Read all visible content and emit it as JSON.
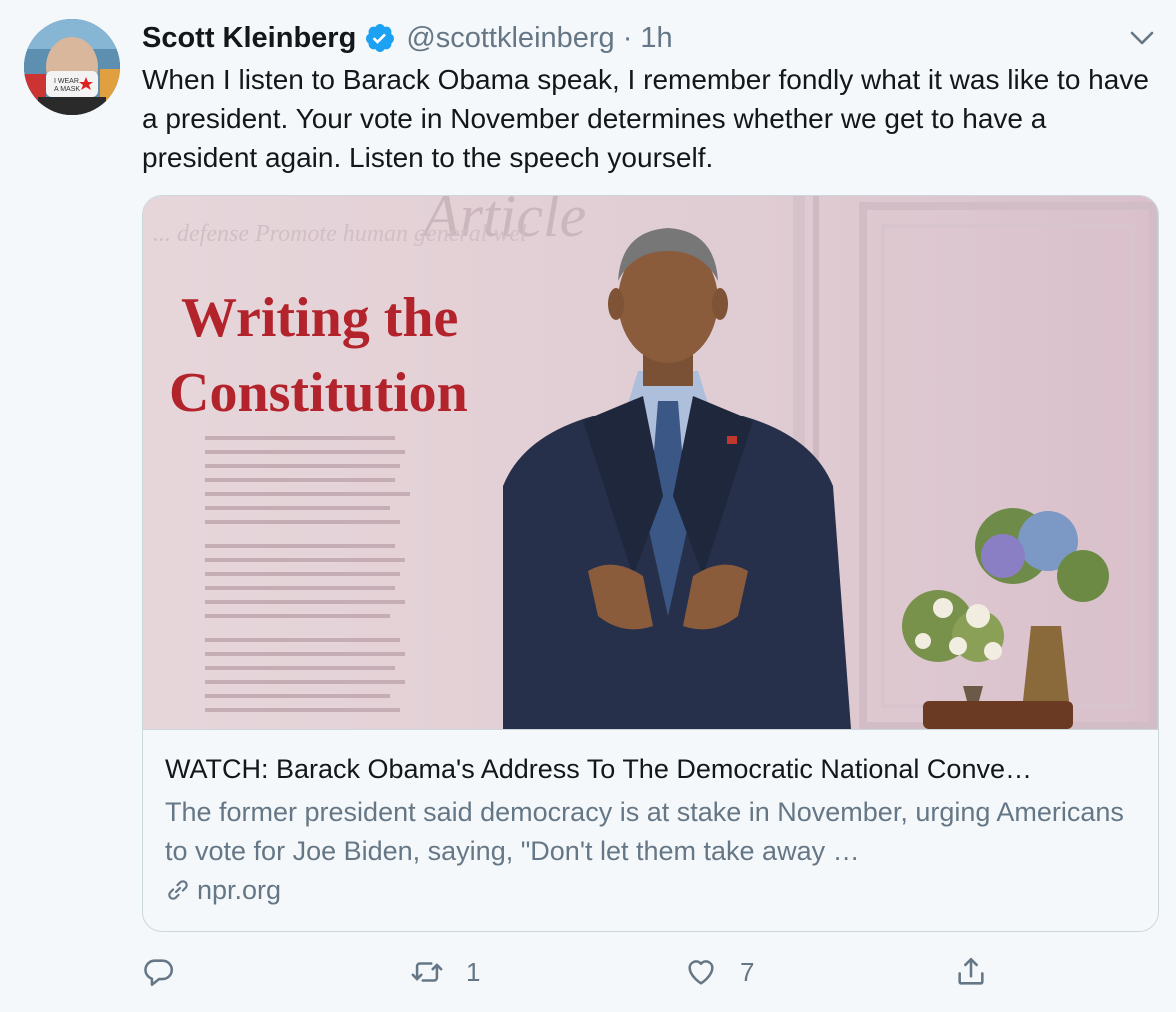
{
  "tweet": {
    "author_name": "Scott Kleinberg",
    "handle": "@scottkleinberg",
    "separator": "·",
    "time": "1h",
    "text": "When I listen to Barack Obama speak, I remember fondly what it was like to have a president. Your vote in November determines whether we get to have a president again. Listen to the speech yourself."
  },
  "card": {
    "image_heading_line1": "Writing the",
    "image_heading_line2": "Constitution",
    "title": "WATCH: Barack Obama's Address To The Democratic National Conve…",
    "description": "The former president said democracy is at stake in November, urging Americans to vote for Joe Biden, saying, \"Don't let them take away …",
    "domain": "npr.org"
  },
  "actions": {
    "reply_count": "",
    "retweet_count": "1",
    "like_count": "7"
  },
  "colors": {
    "verified_blue": "#1da1f2",
    "secondary_text": "#657786",
    "border": "#ccd6dd",
    "heading_red": "#b3232b"
  },
  "icons": [
    "verified-badge-icon",
    "chevron-down-icon",
    "link-icon",
    "reply-icon",
    "retweet-icon",
    "like-icon",
    "share-icon"
  ]
}
